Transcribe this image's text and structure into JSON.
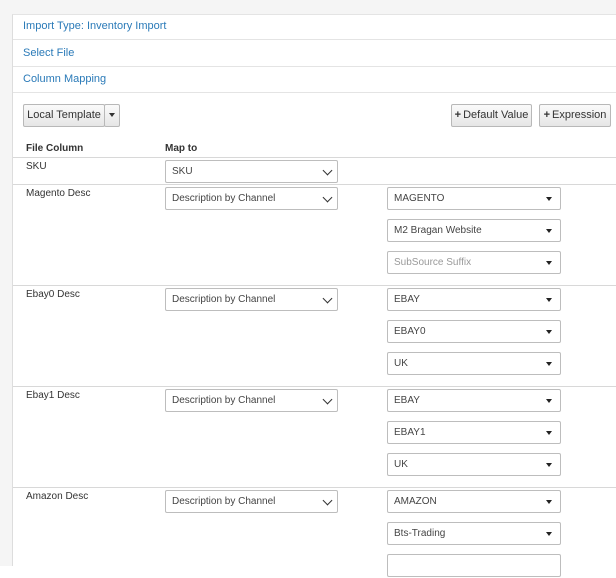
{
  "accordion": {
    "import_type": "Import Type: Inventory Import",
    "select_file": "Select File",
    "column_mapping": "Column Mapping"
  },
  "toolbar": {
    "local_template": "Local Template",
    "default_value": "Default Value",
    "expression": "Expression"
  },
  "table": {
    "col_file": "File Column",
    "col_map": "Map to"
  },
  "rows": [
    {
      "label": "SKU",
      "map_to": "SKU",
      "channels": []
    },
    {
      "label": "Magento Desc",
      "map_to": "Description by Channel",
      "channels": [
        "MAGENTO",
        "M2 Bragan Website",
        "SubSource Suffix"
      ]
    },
    {
      "label": "Ebay0 Desc",
      "map_to": "Description by Channel",
      "channels": [
        "EBAY",
        "EBAY0",
        "UK"
      ]
    },
    {
      "label": "Ebay1 Desc",
      "map_to": "Description by Channel",
      "channels": [
        "EBAY",
        "EBAY1",
        "UK"
      ]
    },
    {
      "label": "Amazon Desc",
      "map_to": "Description by Channel",
      "channels": [
        "AMAZON",
        "Bts-Trading",
        ""
      ]
    }
  ]
}
